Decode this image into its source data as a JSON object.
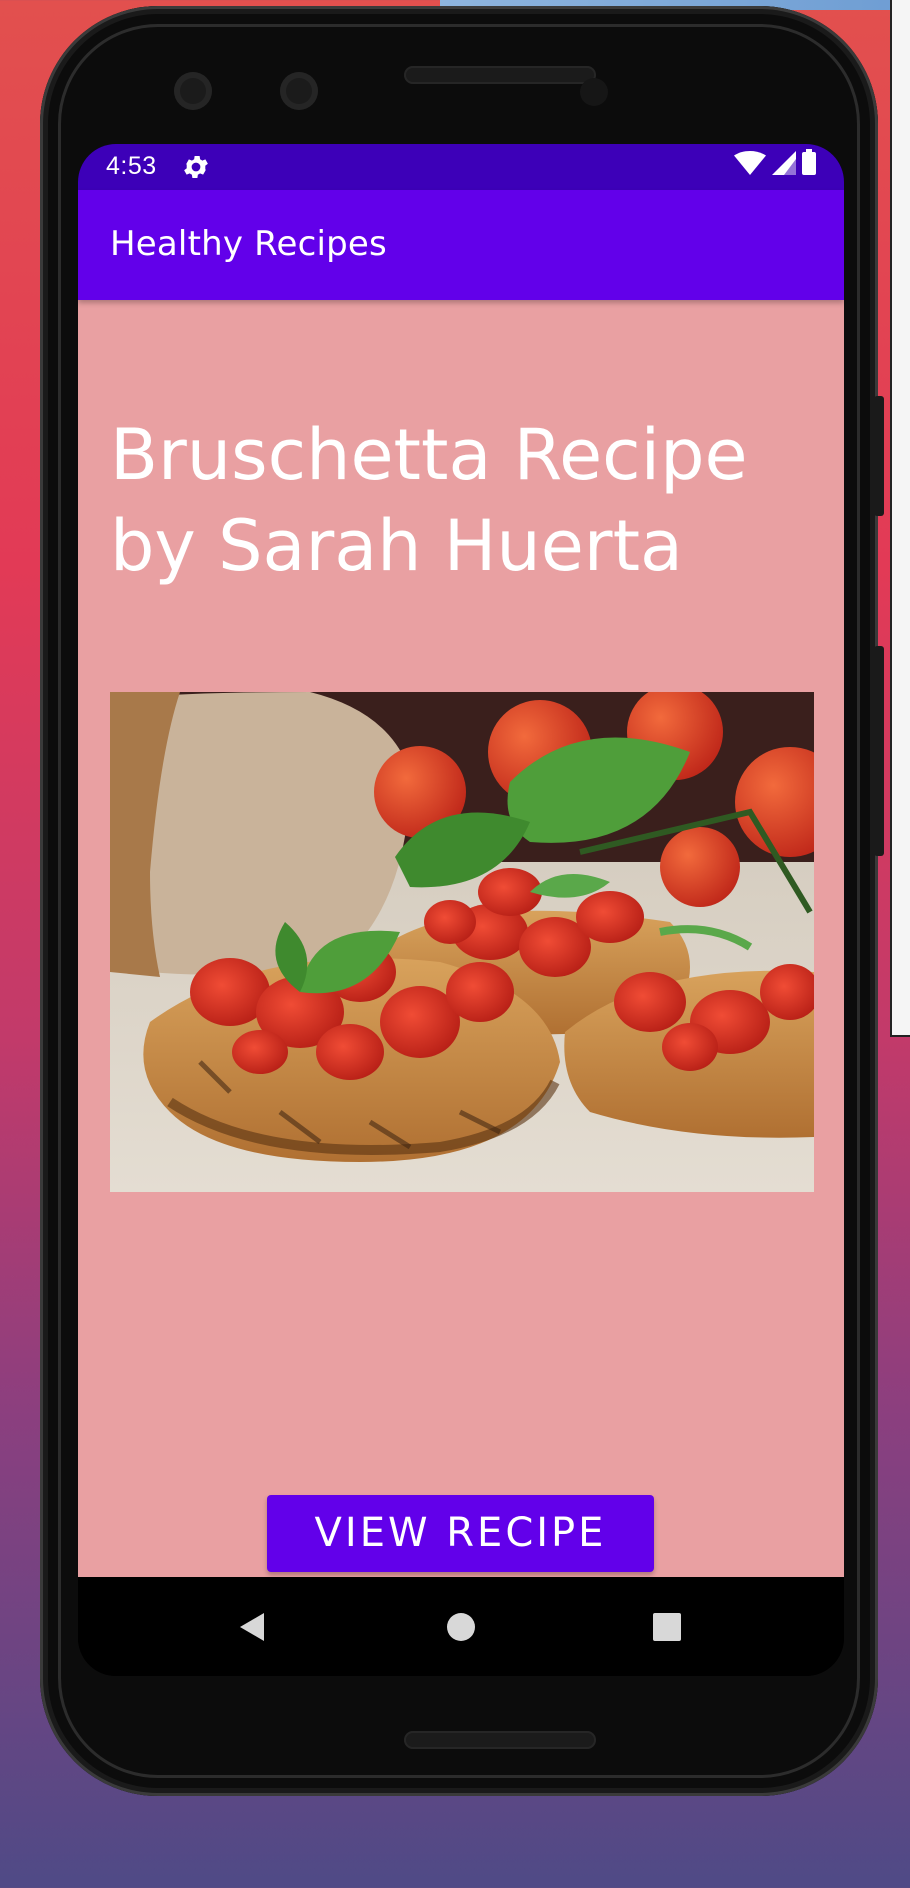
{
  "status_bar": {
    "time": "4:53",
    "icons": [
      "settings-gear-icon",
      "wifi-icon",
      "cell-signal-icon",
      "battery-icon"
    ]
  },
  "app_bar": {
    "title": "Healthy Recipes"
  },
  "main": {
    "title_line1": "Bruschetta Recipe",
    "title_line2": "by Sarah Huerta",
    "image_description": "bruschetta-photo",
    "view_button_label": "VIEW RECIPE"
  },
  "nav_bar": {
    "icons": [
      "back-icon",
      "home-icon",
      "recents-icon"
    ]
  },
  "colors": {
    "primary": "#6200ea",
    "primary_dark": "#3d00b8",
    "background": "#e9a0a2",
    "on_primary": "#ffffff"
  }
}
